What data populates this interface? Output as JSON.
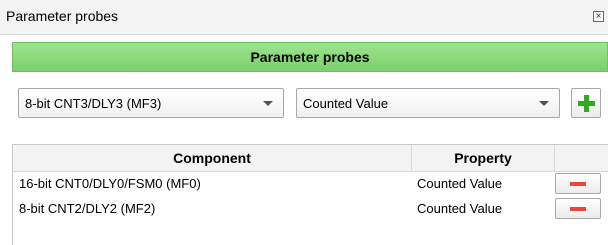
{
  "window": {
    "title": "Parameter probes"
  },
  "header": {
    "title": "Parameter probes"
  },
  "controls": {
    "component_select": "8-bit CNT3/DLY3 (MF3)",
    "property_select": "Counted Value"
  },
  "table": {
    "columns": [
      "Component",
      "Property",
      ""
    ],
    "rows": [
      {
        "component": "16-bit CNT0/DLY0/FSM0 (MF0)",
        "property": "Counted Value"
      },
      {
        "component": "8-bit CNT2/DLY2 (MF2)",
        "property": "Counted Value"
      }
    ]
  },
  "colors": {
    "header_green": "#79d169",
    "add_green": "#34a822",
    "remove_red": "#e8473d"
  },
  "icons": {
    "close": "close-icon",
    "dropdown": "chevron-down-icon",
    "add": "plus-icon",
    "remove": "minus-icon"
  }
}
